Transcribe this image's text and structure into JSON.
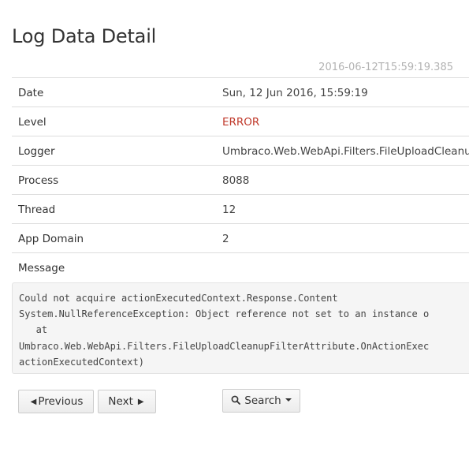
{
  "page": {
    "title": "Log Data Detail",
    "timestamp": "2016-06-12T15:59:19.385"
  },
  "fields": [
    {
      "label": "Date",
      "value": "Sun, 12 Jun 2016, 15:59:19"
    },
    {
      "label": "Level",
      "value": "ERROR"
    },
    {
      "label": "Logger",
      "value": "Umbraco.Web.WebApi.Filters.FileUploadCleanup"
    },
    {
      "label": "Process",
      "value": "8088"
    },
    {
      "label": "Thread",
      "value": "12"
    },
    {
      "label": "App Domain",
      "value": "2"
    },
    {
      "label": "Message",
      "value": ""
    }
  ],
  "message": {
    "lines": [
      "Could not acquire actionExecutedContext.Response.Content",
      "System.NullReferenceException: Object reference not set to an instance o",
      "   at",
      "Umbraco.Web.WebApi.Filters.FileUploadCleanupFilterAttribute.OnActionExec",
      "actionExecutedContext)"
    ]
  },
  "buttons": {
    "previous": "Previous",
    "next": "Next",
    "search": "Search"
  },
  "colors": {
    "error": "#c0392b",
    "timestamp": "#b3b3b3"
  }
}
